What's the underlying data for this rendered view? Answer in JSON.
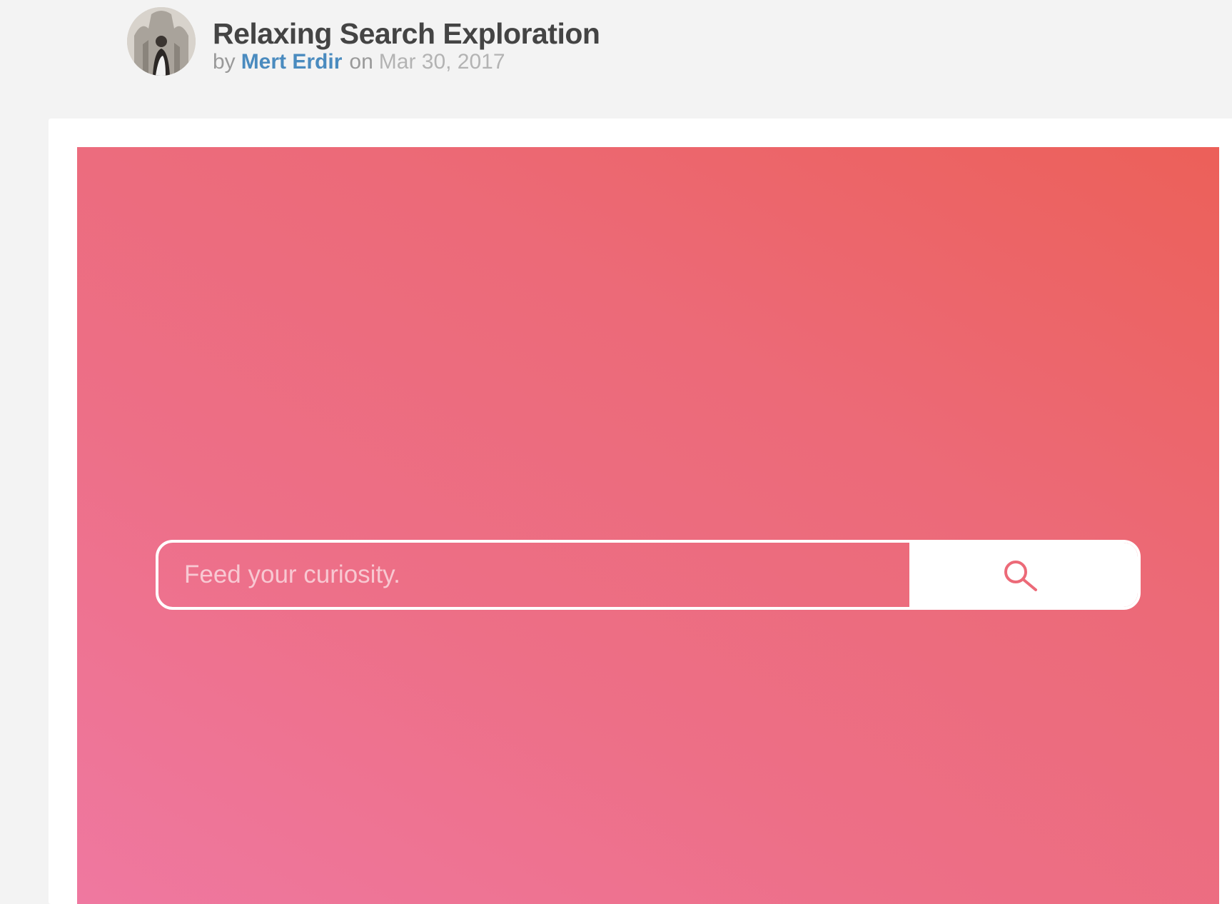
{
  "shot": {
    "title": "Relaxing Search Exploration",
    "by_label": "by",
    "author": "Mert Erdir",
    "on_label": "on",
    "date": "Mar 30, 2017"
  },
  "preview": {
    "search_placeholder": "Feed your curiosity.",
    "search_icon": "search-icon",
    "gradient_colors": [
      "#ef78a0",
      "#ec6059"
    ],
    "accent": "#ec6a78"
  }
}
